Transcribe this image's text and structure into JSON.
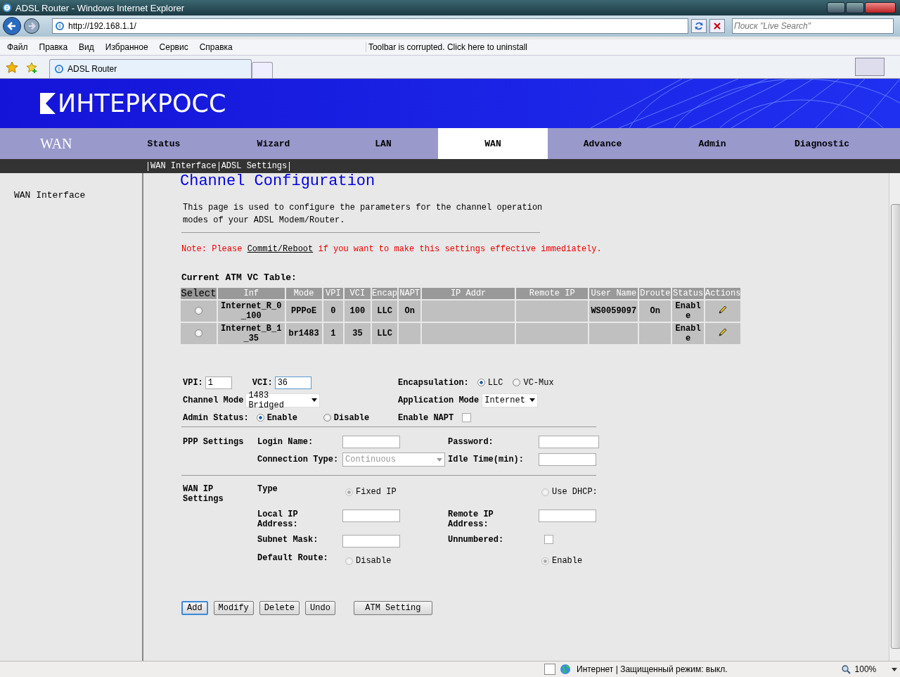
{
  "browser": {
    "title": "ADSL Router - Windows Internet Explorer",
    "url": "http://192.168.1.1/",
    "search_placeholder": "Поиск \"Live Search\"",
    "menu": [
      "Файл",
      "Правка",
      "Вид",
      "Избранное",
      "Сервис",
      "Справка"
    ],
    "toolbar_notice": "Toolbar is corrupted. Click here to uninstall",
    "tab": "ADSL Router",
    "status_zone": "Интернет | Защищенный режим: выкл.",
    "zoom": "100%"
  },
  "header": {
    "logo": "ИНТЕРКРОСС"
  },
  "nav": {
    "section": "WAN",
    "tabs": [
      {
        "label": "Status",
        "selected": false
      },
      {
        "label": "Wizard",
        "selected": false
      },
      {
        "label": "LAN",
        "selected": false
      },
      {
        "label": "WAN",
        "selected": true
      },
      {
        "label": "Advance",
        "selected": false
      },
      {
        "label": "Admin",
        "selected": false
      },
      {
        "label": "Diagnostic",
        "selected": false
      }
    ],
    "subnav": [
      "WAN Interface",
      "ADSL Settings"
    ]
  },
  "sidebar": {
    "items": [
      "WAN Interface"
    ]
  },
  "page": {
    "heading": "Channel Configuration",
    "description": "This page is used to configure the parameters for the channel operation modes of your ADSL Modem/Router.",
    "note": {
      "before": "Note: Please ",
      "link": "Commit/Reboot",
      "after": " if you want to make this settings effective immediately."
    }
  },
  "table": {
    "title": "Current ATM VC Table:",
    "columns": [
      "Select",
      "Inf",
      "Mode",
      "VPI",
      "VCI",
      "Encap",
      "NAPT",
      "IP Addr",
      "Remote IP",
      "User Name",
      "Droute",
      "Status",
      "Actions"
    ],
    "rows": [
      {
        "selected": false,
        "cells": [
          "",
          "Internet_R_0_100",
          "PPPoE",
          "0",
          "100",
          "LLC",
          "On",
          "",
          "",
          "WS0059097",
          "On",
          "Enable"
        ]
      },
      {
        "selected": false,
        "cells": [
          "",
          "Internet_B_1_35",
          "br1483",
          "1",
          "35",
          "LLC",
          "",
          "",
          "",
          "",
          "",
          "Enable"
        ]
      }
    ]
  },
  "form": {
    "vpi": {
      "label": "VPI:",
      "value": "1"
    },
    "vci": {
      "label": "VCI:",
      "value": "36"
    },
    "encapsulation": {
      "label": "Encapsulation:",
      "options": [
        {
          "label": "LLC",
          "selected": true
        },
        {
          "label": "VC-Mux",
          "selected": false
        }
      ]
    },
    "channel_mode": {
      "label": "Channel Mode",
      "value": "1483 Bridged"
    },
    "application_mode": {
      "label": "Application Mode",
      "value": "Internet"
    },
    "admin_status": {
      "label": "Admin Status:",
      "options": [
        {
          "label": "Enable",
          "selected": true
        },
        {
          "label": "Disable",
          "selected": false
        }
      ]
    },
    "enable_napt": {
      "label": "Enable NAPT",
      "checked": false
    },
    "ppp": {
      "section": "PPP Settings",
      "login_name": "Login Name:",
      "password": "Password:",
      "connection_type": {
        "label": "Connection Type:",
        "value": "Continuous",
        "disabled": true
      },
      "idle_time": "Idle Time(min):"
    },
    "wan_ip": {
      "section": "WAN IP Settings",
      "disabled": true,
      "type": {
        "label": "Type",
        "options": [
          {
            "label": "Fixed IP",
            "selected": true
          },
          {
            "label": "Use DHCP:",
            "selected": false
          }
        ]
      },
      "local_ip": "Local IP Address:",
      "remote_ip": "Remote IP Address:",
      "subnet_mask": "Subnet Mask:",
      "unnumbered": {
        "label": "Unnumbered:",
        "checked": false
      },
      "default_route": {
        "label": "Default Route:",
        "options": [
          {
            "label": "Disable",
            "selected": false
          },
          {
            "label": "Enable",
            "selected": true
          }
        ]
      }
    },
    "buttons": [
      {
        "label": "Add",
        "focused": true
      },
      {
        "label": "Modify",
        "focused": false
      },
      {
        "label": "Delete",
        "focused": false
      },
      {
        "label": "Undo",
        "focused": false
      },
      {
        "label": "ATM Setting",
        "focused": false
      }
    ]
  }
}
